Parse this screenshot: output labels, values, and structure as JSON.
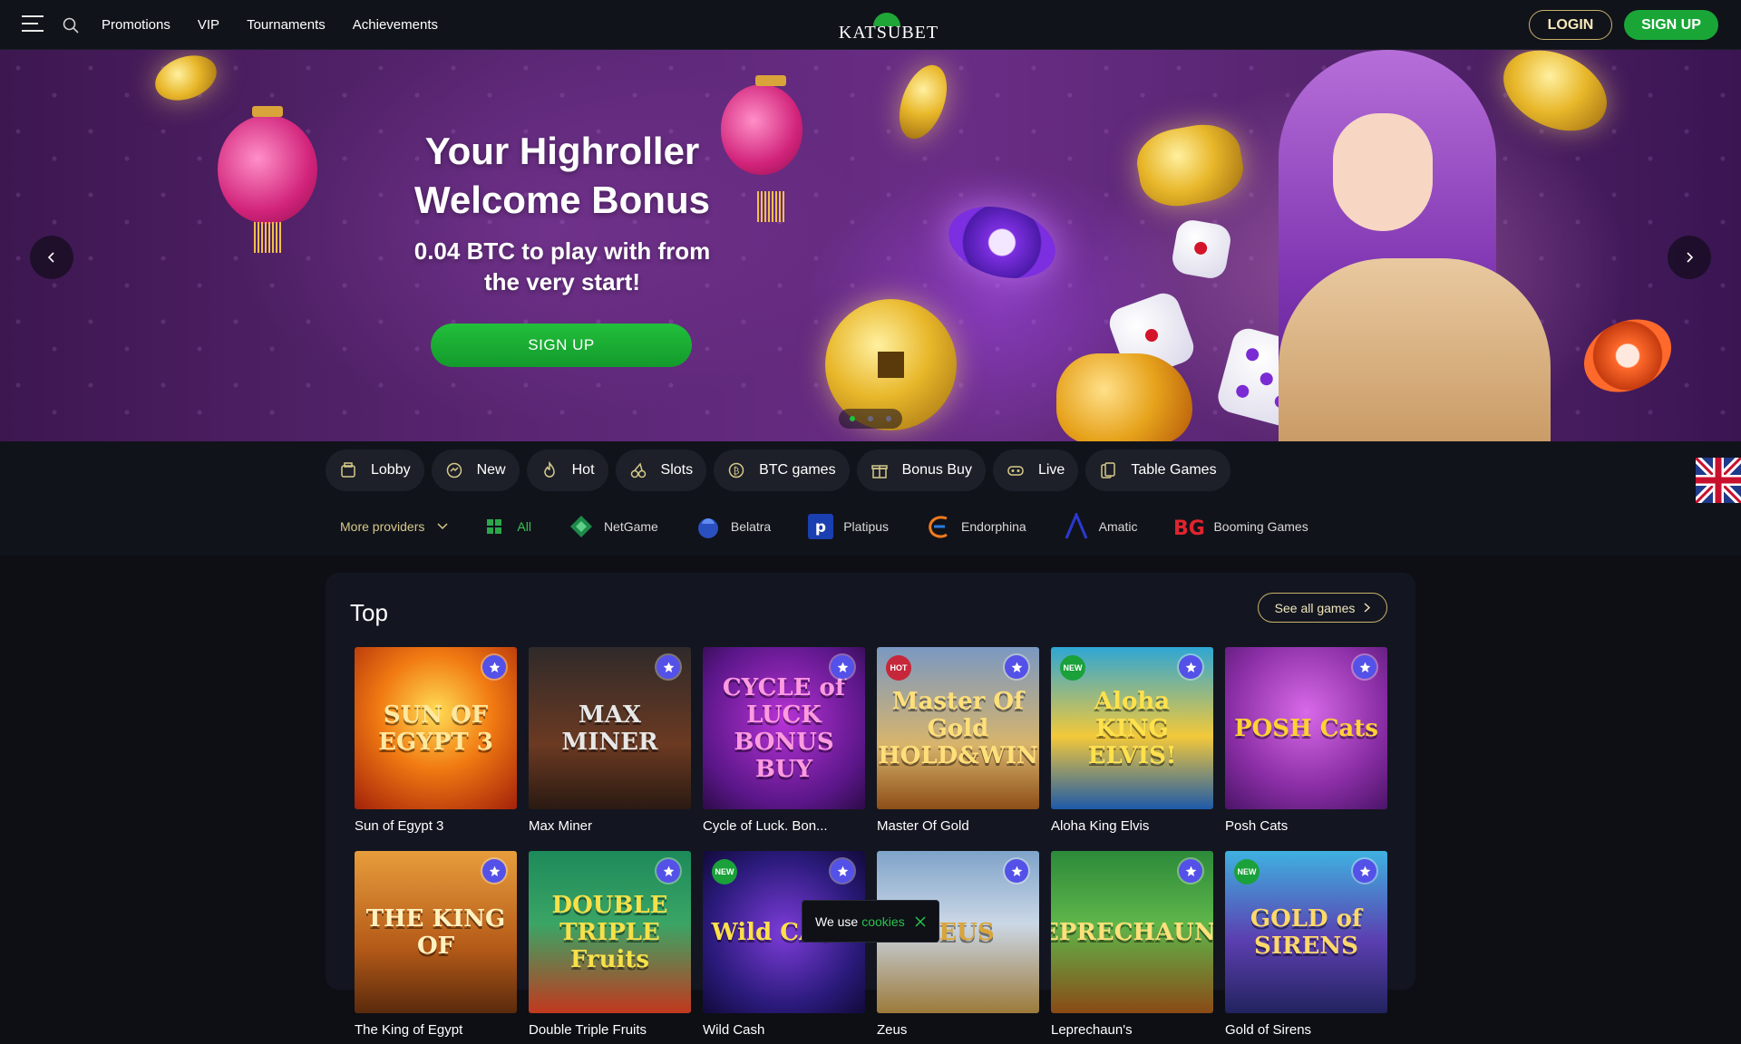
{
  "header": {
    "nav": [
      "Promotions",
      "VIP",
      "Tournaments",
      "Achievements"
    ],
    "logo": "KATSUBET",
    "login": "LOGIN",
    "signup": "SIGN UP"
  },
  "hero": {
    "title_line1": "Your Highroller",
    "title_line2": "Welcome Bonus",
    "subtitle_line1": "0.04 BTC to play with from",
    "subtitle_line2": "the very start!",
    "cta": "SIGN UP",
    "slides": 3,
    "active_slide": 1
  },
  "categories": [
    {
      "label": "Lobby",
      "icon": "lobby-icon"
    },
    {
      "label": "New",
      "icon": "new-icon"
    },
    {
      "label": "Hot",
      "icon": "fire-icon"
    },
    {
      "label": "Slots",
      "icon": "cherry-icon"
    },
    {
      "label": "BTC games",
      "icon": "bitcoin-icon"
    },
    {
      "label": "Bonus Buy",
      "icon": "gift-icon"
    },
    {
      "label": "Live",
      "icon": "live-icon"
    },
    {
      "label": "Table Games",
      "icon": "cards-icon"
    }
  ],
  "providers": {
    "more": "More providers",
    "all": "All",
    "list": [
      "NetGame",
      "Belatra",
      "Platipus",
      "Endorphina",
      "Amatic",
      "Booming Games"
    ]
  },
  "section": {
    "title": "Top",
    "see_all": "See all games"
  },
  "games": [
    {
      "name": "Sun of Egypt 3",
      "art": "SUN OF EGYPT 3",
      "badge": "",
      "bg": "radial-gradient(circle at 50% 40%, #ffdd55, #f17a12 45%, #a3210a)",
      "fg": "#ffe9a0"
    },
    {
      "name": "Max Miner",
      "art": "MAX MINER",
      "badge": "",
      "bg": "linear-gradient(180deg, #2f2a2a, #6b3a22 60%, #2a1a12)",
      "fg": "#e7e7e7"
    },
    {
      "name": "Cycle of Luck. Bon...",
      "art": "CYCLE of LUCK BONUS BUY",
      "badge": "",
      "bg": "radial-gradient(circle at 50% 45%, #b733d6, #5a1688 70%, #2d0b48)",
      "fg": "#ff9ae0"
    },
    {
      "name": "Master Of Gold",
      "art": "Master Of Gold HOLD&WIN",
      "badge": "HOT",
      "bg": "linear-gradient(180deg, #7a98c2, #d7b46c 60%, #8d4e17)",
      "fg": "#ffdf7a"
    },
    {
      "name": "Aloha King Elvis",
      "art": "Aloha KING ELVIS!",
      "badge": "NEW",
      "bg": "linear-gradient(180deg, #2ea6d4, #f3c93a 55%, #1d5aa8)",
      "fg": "#ffe14d"
    },
    {
      "name": "Posh Cats",
      "art": "POSH Cats",
      "badge": "",
      "bg": "radial-gradient(circle at 50% 40%, #d869e8, #8a2ea5 60%, #4b1468)",
      "fg": "#ffd233"
    },
    {
      "name": "The King of Egypt",
      "art": "THE KING OF",
      "badge": "",
      "bg": "linear-gradient(180deg, #e89d3c, #b45a18 60%, #5a2a0c)",
      "fg": "#fff2c0"
    },
    {
      "name": "Double Triple Fruits",
      "art": "DOUBLE TRIPLE Fruits",
      "badge": "",
      "bg": "linear-gradient(180deg, #1d8a5a, #3aa565 45%, #c2381e)",
      "fg": "#f7e04a"
    },
    {
      "name": "Wild Cash",
      "art": "Wild CASH",
      "badge": "NEW",
      "bg": "radial-gradient(circle at 50% 50%, #7c3cd8, #2a1a7a 65%, #120a3a)",
      "fg": "#ffe04a"
    },
    {
      "name": "Zeus",
      "art": "ZEUS",
      "badge": "",
      "bg": "linear-gradient(180deg, #7fa3c9, #cbd7e6 45%, #9c7a3a)",
      "fg": "#d9a53a"
    },
    {
      "name": "Leprechaun's",
      "art": "LEPRECHAUN'S",
      "badge": "",
      "bg": "linear-gradient(180deg, #2c8a3a, #5fb64a 45%, #8a4a16)",
      "fg": "#ffe07a"
    },
    {
      "name": "Gold of Sirens",
      "art": "GOLD of SIRENS",
      "badge": "NEW",
      "bg": "linear-gradient(180deg, #3fb1e0, #5b3fb0 55%, #22235e)",
      "fg": "#ffd86a"
    }
  ],
  "cookie": {
    "text": "We use",
    "link": "cookies"
  },
  "colors": {
    "accent": "#19a637",
    "gold_border": "#c7b26a",
    "fav": "#5451e8"
  }
}
